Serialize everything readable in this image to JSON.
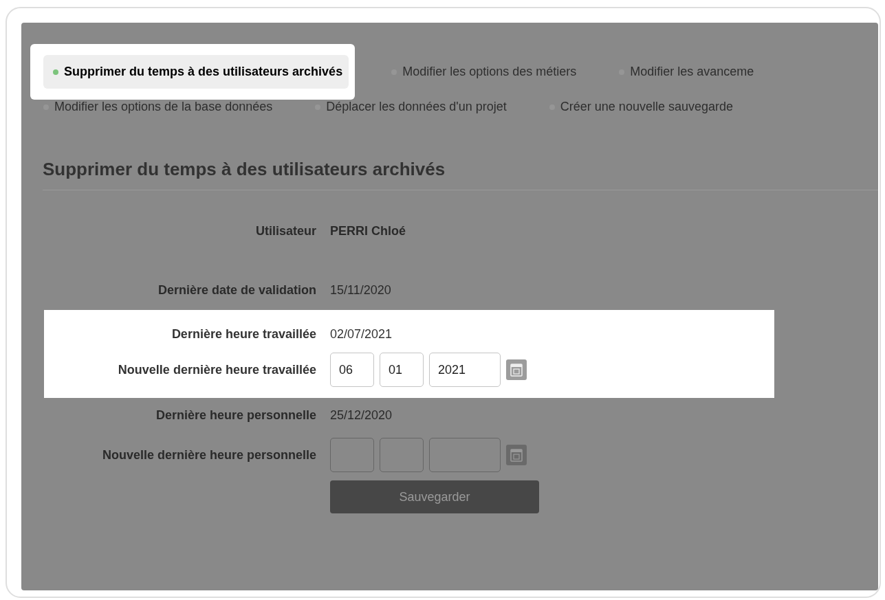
{
  "tab_rows": [
    [
      {
        "label": "Supprimer du temps à des utilisateurs archivés",
        "selected": true,
        "highlighted": true
      },
      {
        "label": "Modifier les options des métiers",
        "selected": false,
        "highlighted": false
      },
      {
        "label": "Modifier les avanceme",
        "selected": false,
        "highlighted": false
      }
    ],
    [
      {
        "label": "Modifier les options de la base données",
        "selected": false,
        "highlighted": false
      },
      {
        "label": "Déplacer les données d'un projet",
        "selected": false,
        "highlighted": false
      },
      {
        "label": "Créer une nouvelle sauvegarde",
        "selected": false,
        "highlighted": false
      }
    ]
  ],
  "heading": "Supprimer du temps à des utilisateurs archivés",
  "form_rows": [
    {
      "kind": "text",
      "label": "Utilisateur",
      "value": "PERRI Chloé",
      "bold": true,
      "highlighted": false
    },
    {
      "kind": "text",
      "label": "Dernière date de validation",
      "value": "15/11/2020",
      "bold": false,
      "highlighted": false
    },
    {
      "kind": "text",
      "label": "Dernière heure travaillée",
      "value": "02/07/2021",
      "bold": false,
      "highlighted": true
    },
    {
      "kind": "date",
      "label": "Nouvelle dernière heure travaillée",
      "day": "06",
      "month": "01",
      "year": "2021",
      "highlighted": true
    },
    {
      "kind": "text",
      "label": "Dernière heure personnelle",
      "value": "25/12/2020",
      "bold": false,
      "highlighted": false
    },
    {
      "kind": "date",
      "label": "Nouvelle dernière heure personnelle",
      "highlighted": false
    }
  ],
  "save_button": "Sauvegarder"
}
